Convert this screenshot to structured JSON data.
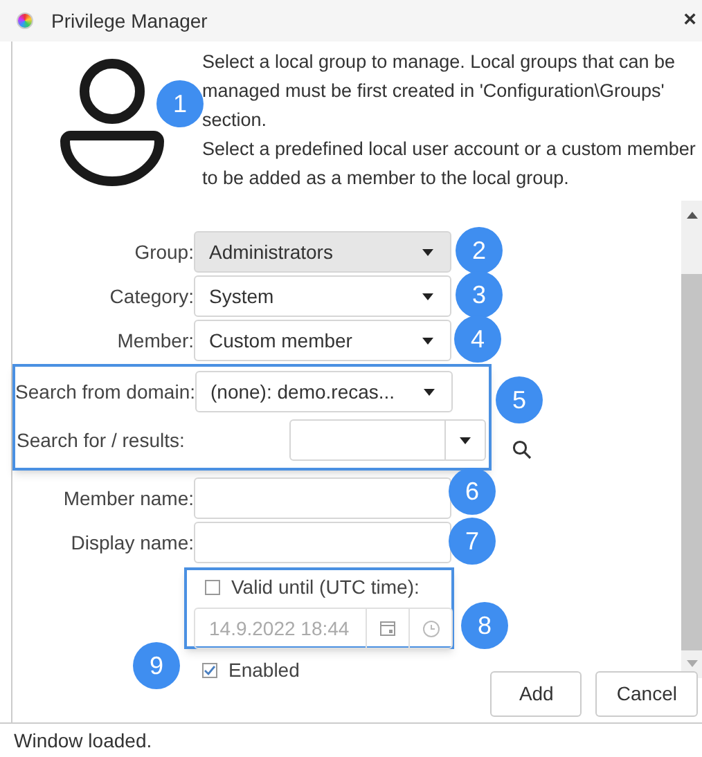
{
  "window": {
    "title": "Privilege Manager",
    "close": "×"
  },
  "description": [
    "Select a local group to manage. Local groups that can be managed must be first created in 'Configuration\\Groups' section.",
    "Select a predefined local user account or a custom member to be added as a member to the local group."
  ],
  "selects": [
    {
      "label": "Group:",
      "value": "Administrators",
      "disabled": true
    },
    {
      "label": "Category:",
      "value": "System",
      "disabled": false
    },
    {
      "label": "Member:",
      "value": "Custom member",
      "disabled": false
    }
  ],
  "search": {
    "domain_label": "Search from domain:",
    "domain_value": "(none): demo.recas...",
    "results_label": "Search for / results:"
  },
  "text_fields": [
    {
      "label": "Member name:"
    },
    {
      "label": "Display name:"
    }
  ],
  "valid_until": {
    "label": "Valid until (UTC time):",
    "checked": false,
    "value": "14.9.2022 18:44"
  },
  "enabled": {
    "label": "Enabled",
    "checked": true
  },
  "buttons": [
    "Add",
    "Cancel"
  ],
  "status_bar": "Window loaded.",
  "callouts": [
    "1",
    "2",
    "3",
    "4",
    "5",
    "6",
    "7",
    "8",
    "9"
  ]
}
